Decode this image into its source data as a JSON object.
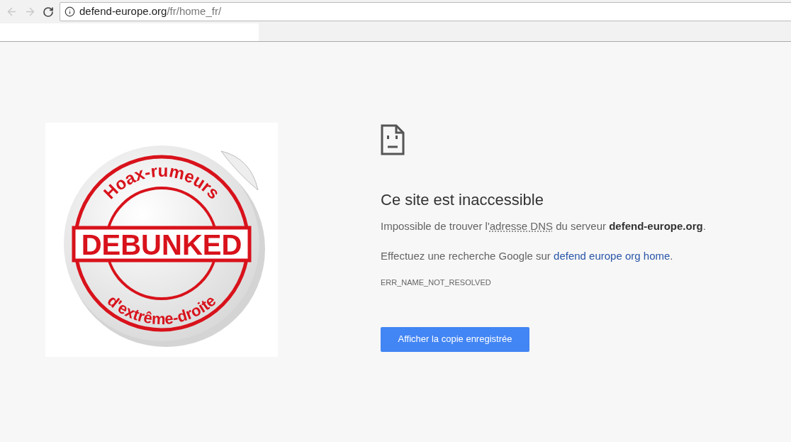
{
  "toolbar": {
    "back": {
      "disabled": true
    },
    "forward": {
      "disabled": true
    },
    "address": {
      "host": "defend-europe.org",
      "path": "/fr/home_fr/"
    }
  },
  "sticker": {
    "top_text": "Hoax-rumeurs",
    "center_text": "DEBUNKED",
    "bottom_text": "d'extrême-droite"
  },
  "error": {
    "title": "Ce site est inaccessible",
    "line_1": [
      {
        "kind": "text",
        "text": "Impossible de trouver l'"
      },
      {
        "kind": "abbr",
        "text": "adresse DNS"
      },
      {
        "kind": "text",
        "text": " du serveur "
      },
      {
        "kind": "bold",
        "text": "defend-europe.org"
      },
      {
        "kind": "text",
        "text": "."
      }
    ],
    "line_2": [
      {
        "kind": "text",
        "text": "Effectuez une recherche Google sur "
      },
      {
        "kind": "link",
        "text": "defend europe org home"
      },
      {
        "kind": "text",
        "text": "."
      }
    ],
    "code": "ERR_NAME_NOT_RESOLVED",
    "button": "Afficher la copie enregistrée"
  }
}
